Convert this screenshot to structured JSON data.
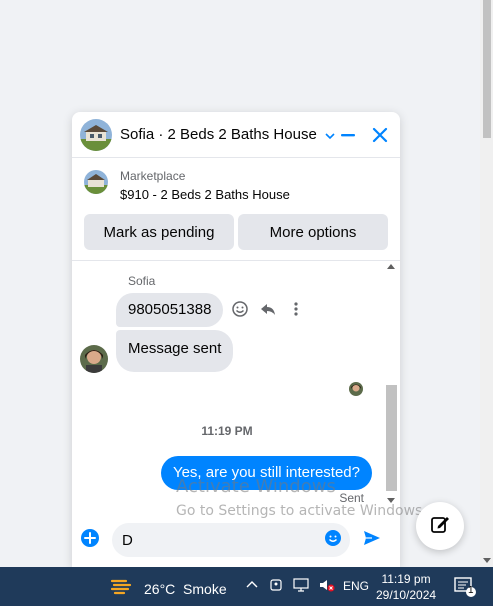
{
  "chat": {
    "title": "Sofia · 2 Beds 2 Baths House",
    "marketplace_label": "Marketplace",
    "listing": "$910 - 2 Beds 2 Baths House",
    "btn_pending": "Mark as pending",
    "btn_more": "More options"
  },
  "messages": {
    "sender": "Sofia",
    "incoming": [
      "9805051388",
      "Message sent"
    ],
    "timestamp": "11:19 PM",
    "outgoing": "Yes, are you still interested?",
    "status": "Sent"
  },
  "composer": {
    "value": "D",
    "placeholder": ""
  },
  "watermark": {
    "line1": "Activate Windows",
    "line2": "Go to Settings to activate Windows."
  },
  "taskbar": {
    "weather": "26°C  Smoke",
    "lang": "ENG",
    "time": "11:19 pm",
    "date": "29/10/2024",
    "notif_count": "1"
  },
  "colors": {
    "accent": "#0084ff",
    "taskbar": "#1f3a5a"
  }
}
